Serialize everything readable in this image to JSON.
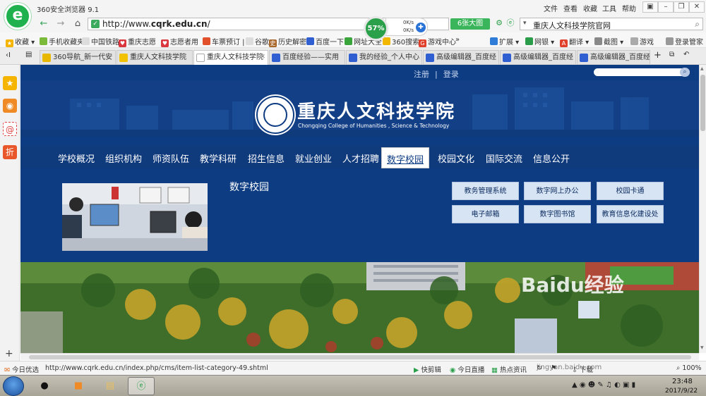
{
  "browser": {
    "title": "360安全浏览器 9.1",
    "menu": [
      "文件",
      "查看",
      "收藏",
      "工具",
      "帮助"
    ],
    "url_prefix": "http://www.",
    "url_domain": "cqrk.edu.cn",
    "url_suffix": "/",
    "speed_percent": "57%",
    "speed_up": "0K/s",
    "speed_down": "0K/s",
    "big_pic_button": "6张大图",
    "search_text": "重庆人文科技学院官网",
    "favorites": [
      "收藏",
      "手机收藏夹",
      "中国铁路",
      "重庆志愿",
      "志愿者用",
      "车票预订",
      "谷歌",
      "历史解密",
      "百度一下",
      "网址大全",
      "360搜索",
      "游戏中心",
      "»"
    ],
    "right_tools": [
      "扩展",
      "网银",
      "翻译",
      "截图",
      "游戏",
      "登录管家"
    ],
    "tabs": [
      "360导航_新一代安",
      "重庆人文科技学院",
      "重庆人文科技学院",
      "百度经验——实用",
      "我的经验_个人中心",
      "高级编辑器_百度经",
      "高级编辑器_百度经",
      "高级编辑器_百度经"
    ],
    "tab_add": "+",
    "status_url": "http://www.cqrk.edu.cn/index.php/cms/item-list-category-49.shtml",
    "status_left": "今日优选",
    "status_items": [
      "快剪辑",
      "今日直播",
      "热点资讯",
      "下载",
      "100%"
    ]
  },
  "site": {
    "top_links": [
      "注册",
      "|",
      "登录"
    ],
    "college_name_cn": "重庆人文科技学院",
    "college_name_en": "Chongqing College of Humanities , Science & Technology",
    "nav": [
      "学校概况",
      "组织机构",
      "师资队伍",
      "教学科研",
      "招生信息",
      "就业创业",
      "人才招聘",
      "数字校园",
      "校园文化",
      "国际交流",
      "信息公开"
    ],
    "active_nav": "数字校园",
    "panel_heading": "数字校园",
    "panel_buttons": [
      "教务管理系统",
      "数字网上办公",
      "校园卡通",
      "电子邮箱",
      "数字图书馆",
      "教育信息化建设处"
    ]
  },
  "watermark": {
    "brand": "Baidu经验",
    "sub": "jingyan.baidu.com"
  },
  "taskbar": {
    "time": "23:48",
    "date": "2017/9/22"
  },
  "colors": {
    "site_blue": "#0d3c82",
    "browser_green": "#2aa04a",
    "panel_button": "#d6e4f4"
  }
}
